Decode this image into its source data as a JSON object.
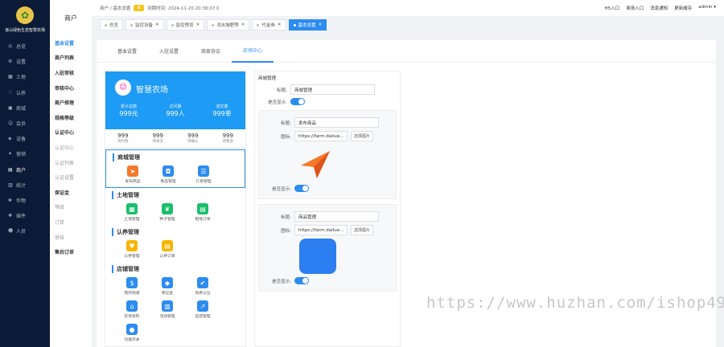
{
  "brand": {
    "name": "该山绿色生态智慧农场"
  },
  "sidebar": {
    "items": [
      {
        "label": "总览",
        "icon": "dashboard-icon"
      },
      {
        "label": "设置",
        "icon": "gear-icon"
      },
      {
        "label": "土地",
        "icon": "land-icon"
      },
      {
        "label": "认养",
        "icon": "adopt-icon"
      },
      {
        "label": "商城",
        "icon": "shop-icon"
      },
      {
        "label": "会员",
        "icon": "member-icon"
      },
      {
        "label": "设备",
        "icon": "device-icon"
      },
      {
        "label": "营销",
        "icon": "marketing-icon"
      },
      {
        "label": "商户",
        "icon": "merchant-icon"
      },
      {
        "label": "统计",
        "icon": "stats-icon"
      },
      {
        "label": "作物",
        "icon": "crop-icon"
      },
      {
        "label": "插件",
        "icon": "plugin-icon"
      },
      {
        "label": "人员",
        "icon": "staff-icon"
      }
    ]
  },
  "subnav": {
    "title": "商户",
    "items": [
      {
        "label": "基本设置",
        "state": "active"
      },
      {
        "label": "商户列表",
        "state": "bold"
      },
      {
        "label": "入驻审核",
        "state": "bold"
      },
      {
        "label": "审核中心",
        "state": "bold"
      },
      {
        "label": "商户修理",
        "state": "bold"
      },
      {
        "label": "规格等级",
        "state": "bold"
      },
      {
        "label": "认证中心",
        "state": "bold"
      },
      {
        "label": "认证中心",
        "state": "muted"
      },
      {
        "label": "认证列表",
        "state": "muted"
      },
      {
        "label": "认证设置",
        "state": "muted"
      },
      {
        "label": "保证金",
        "state": "bold"
      },
      {
        "label": "等级",
        "state": "muted"
      },
      {
        "label": "订单",
        "state": "muted"
      },
      {
        "label": "审核",
        "state": "muted"
      },
      {
        "label": "售后订单",
        "state": "bold"
      }
    ]
  },
  "topbar": {
    "breadcrumb": "商户 / 基本设置",
    "badge": "♛",
    "expire": "到期时间: 2024-11-20 20:38:07.0",
    "links": [
      "H5入口",
      "商场入口",
      "消息通知",
      "更新缓存",
      "admin ▾"
    ]
  },
  "tabs": [
    {
      "label": "总览"
    },
    {
      "label": "监控设备"
    },
    {
      "label": "监控预览"
    },
    {
      "label": "浇水施肥等"
    },
    {
      "label": "代金券"
    },
    {
      "label": "基本设置",
      "active": true
    }
  ],
  "content_tabs": [
    {
      "label": "基本设置"
    },
    {
      "label": "入驻设置"
    },
    {
      "label": "商家协议"
    },
    {
      "label": "农场中心",
      "active": true
    }
  ],
  "phone": {
    "farm_name": "智慧农场",
    "stats": [
      {
        "label": "累计总额",
        "value": "999元"
      },
      {
        "label": "访问量",
        "value": "999人"
      },
      {
        "label": "成交量",
        "value": "999单"
      }
    ],
    "orders": [
      {
        "num": "999",
        "label": "待付款"
      },
      {
        "num": "999",
        "label": "待发货"
      },
      {
        "num": "999",
        "label": "待确认"
      },
      {
        "num": "999",
        "label": "待售后"
      }
    ],
    "sections": [
      {
        "title": "商城管理",
        "items": [
          {
            "label": "发布商品",
            "color": "#f5792a",
            "icon": "plane-icon"
          },
          {
            "label": "商品管理",
            "color": "#2d8cf0",
            "icon": "bag-icon"
          },
          {
            "label": "订单管理",
            "color": "#2d8cf0",
            "icon": "list-icon"
          }
        ]
      },
      {
        "title": "土地管理",
        "items": [
          {
            "label": "土地管理",
            "color": "#19be6b",
            "icon": "grid-icon"
          },
          {
            "label": "种子管理",
            "color": "#19be6b",
            "icon": "leaf-icon"
          },
          {
            "label": "租地订单",
            "color": "#19be6b",
            "icon": "order-icon"
          }
        ]
      },
      {
        "title": "认养管理",
        "items": [
          {
            "label": "认养管理",
            "color": "#f7b500",
            "icon": "heart-icon"
          },
          {
            "label": "认养订单",
            "color": "#f7b500",
            "icon": "order-icon"
          }
        ]
      },
      {
        "title": "店铺管理",
        "items": [
          {
            "label": "我的钱袋",
            "color": "#2d8cf0",
            "icon": "purse-icon"
          },
          {
            "label": "保证金",
            "color": "#2d8cf0",
            "icon": "shield-icon"
          },
          {
            "label": "资质认证",
            "color": "#2d8cf0",
            "icon": "shield-check-icon"
          },
          {
            "label": "农场资料",
            "color": "#2d8cf0",
            "icon": "store-icon"
          },
          {
            "label": "活动管理",
            "color": "#2d8cf0",
            "icon": "activity-icon"
          },
          {
            "label": "监控管理",
            "color": "#2d8cf0",
            "icon": "chart-icon"
          },
          {
            "label": "功能开关",
            "color": "#2d8cf0",
            "icon": "switch-icon"
          }
        ]
      }
    ]
  },
  "editor": {
    "group_label": "商城管理",
    "title_label": "标题:",
    "title_value": "商城管理",
    "show_label": "是否显示:",
    "items": [
      {
        "title_label": "标题:",
        "title_value": "发布商品",
        "pic_label": "图标:",
        "pic_value": "https://farm.dailue...",
        "pic_button": "选择图片",
        "show_label": "是否显示:",
        "icon": "plane"
      },
      {
        "title_label": "标题:",
        "title_value": "商品管理",
        "pic_label": "图标:",
        "pic_value": "https://farm.dailue...",
        "pic_button": "选择图片",
        "show_label": "是否显示:",
        "icon": "bag"
      }
    ]
  },
  "watermark": "https://www.huzhan.com/ishop49288"
}
